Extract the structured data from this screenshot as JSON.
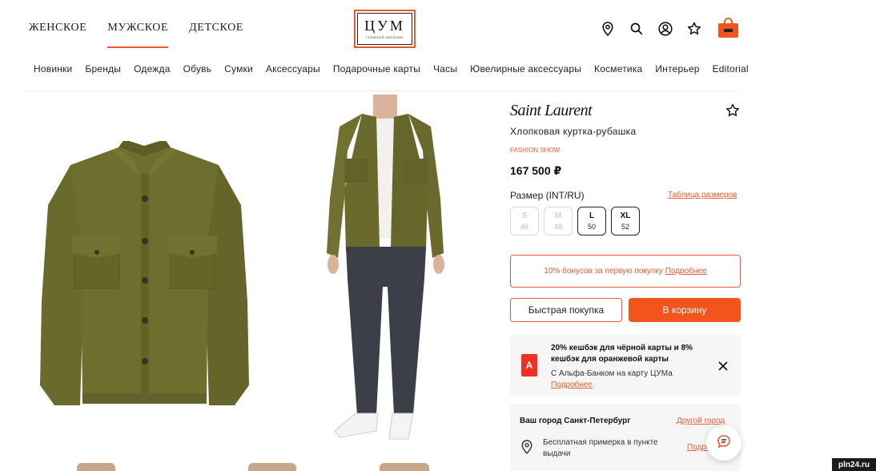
{
  "header": {
    "gender_tabs": [
      {
        "label": "ЖЕНСКОЕ",
        "active": false
      },
      {
        "label": "МУЖСКОЕ",
        "active": true
      },
      {
        "label": "ДЕТСКОЕ",
        "active": false
      }
    ],
    "logo_text": "ЦУМ",
    "logo_subtext": "ГЛАВНЫЙ МАГАЗИН",
    "icons": [
      "location-icon",
      "search-icon",
      "account-icon",
      "favorites-icon",
      "cart-icon"
    ]
  },
  "categories": [
    "Новинки",
    "Бренды",
    "Одежда",
    "Обувь",
    "Сумки",
    "Аксессуары",
    "Подарочные карты",
    "Часы",
    "Ювелирные аксессуары",
    "Косметика",
    "Интерьер",
    "Editorial"
  ],
  "product": {
    "brand": "Saint Laurent",
    "name": "Хлопковая куртка-рубашка",
    "label": "FASHION SHOW",
    "price": "167 500 ₽",
    "size_title": "Размер (INT/RU)",
    "size_table_link": "Таблица размеров",
    "sizes": [
      {
        "label": "S",
        "num": "46",
        "available": false
      },
      {
        "label": "M",
        "num": "48",
        "available": false
      },
      {
        "label": "L",
        "num": "50",
        "available": true
      },
      {
        "label": "XL",
        "num": "52",
        "available": true
      }
    ],
    "bonus_text": "10% бонусов за первую покупку",
    "bonus_link": "Подробнее",
    "quick_buy": "Быстрая покупка",
    "add_to_cart": "В корзину"
  },
  "promo": {
    "bank_letter": "А",
    "title": "20% кешбэк для чёрной карты и 8% кешбэк для оранжевой карты",
    "subtitle": "С Альфа-Банком на карту ЦУМа",
    "link": "Подробнее"
  },
  "city": {
    "title": "Ваш город Санкт-Петербург",
    "other_link": "Другой город",
    "fitting_text": "Бесплатная примерка в пункте выдачи",
    "more_link": "Подро"
  },
  "watermark": "pln24.ru",
  "colors": {
    "accent": "#ef5b2c",
    "jacket": "#6b6a2a",
    "jeans": "#3c3e48"
  }
}
